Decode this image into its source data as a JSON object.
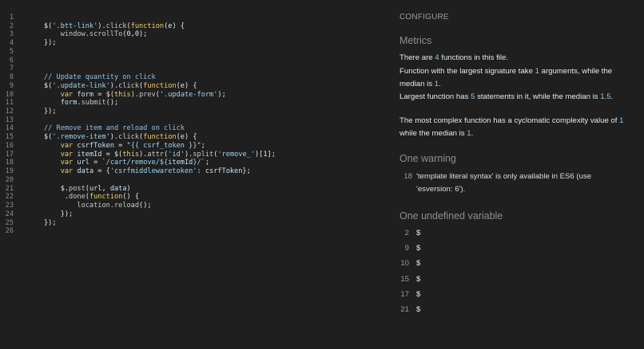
{
  "editor": {
    "lines": [
      {
        "n": "1",
        "code": []
      },
      {
        "n": "2",
        "code": [
          [
            "def",
            "$("
          ],
          [
            "str",
            "'.btt-link'"
          ],
          [
            "def",
            ")."
          ],
          [
            "prop",
            "click"
          ],
          [
            "def",
            "("
          ],
          [
            "kw",
            "function"
          ],
          [
            "def",
            "(e) {"
          ]
        ]
      },
      {
        "n": "3",
        "code": [
          [
            "def",
            "    "
          ],
          [
            "prop",
            "window.scrollTo"
          ],
          [
            "def",
            "(0,0);"
          ]
        ]
      },
      {
        "n": "4",
        "code": [
          [
            "def",
            "});"
          ]
        ]
      },
      {
        "n": "5",
        "code": []
      },
      {
        "n": "6",
        "code": []
      },
      {
        "n": "7",
        "code": []
      },
      {
        "n": "8",
        "code": [
          [
            "com",
            "// Update quantity on click"
          ]
        ]
      },
      {
        "n": "9",
        "code": [
          [
            "def",
            "$("
          ],
          [
            "str",
            "'.update-link'"
          ],
          [
            "def",
            ")."
          ],
          [
            "prop",
            "click"
          ],
          [
            "def",
            "("
          ],
          [
            "kw",
            "function"
          ],
          [
            "def",
            "(e) {"
          ]
        ]
      },
      {
        "n": "10",
        "code": [
          [
            "def",
            "    "
          ],
          [
            "kw",
            "var"
          ],
          [
            "def",
            " "
          ],
          [
            "var",
            "form"
          ],
          [
            "def",
            " = $("
          ],
          [
            "kw",
            "this"
          ],
          [
            "def",
            ")."
          ],
          [
            "prop",
            "prev"
          ],
          [
            "def",
            "("
          ],
          [
            "str",
            "'.update-form'"
          ],
          [
            "def",
            ");"
          ]
        ]
      },
      {
        "n": "11",
        "code": [
          [
            "def",
            "    "
          ],
          [
            "var",
            "form"
          ],
          [
            "def",
            "."
          ],
          [
            "prop",
            "submit"
          ],
          [
            "def",
            "();"
          ]
        ]
      },
      {
        "n": "12",
        "code": [
          [
            "def",
            "});"
          ]
        ]
      },
      {
        "n": "13",
        "code": []
      },
      {
        "n": "14",
        "code": [
          [
            "com",
            "// Remove item and reload on click"
          ]
        ]
      },
      {
        "n": "15",
        "code": [
          [
            "def",
            "$("
          ],
          [
            "str",
            "'.remove-item'"
          ],
          [
            "def",
            ")."
          ],
          [
            "prop",
            "click"
          ],
          [
            "def",
            "("
          ],
          [
            "kw",
            "function"
          ],
          [
            "def",
            "(e) {"
          ]
        ]
      },
      {
        "n": "16",
        "code": [
          [
            "def",
            "    "
          ],
          [
            "kw",
            "var"
          ],
          [
            "def",
            " "
          ],
          [
            "var",
            "csrfToken"
          ],
          [
            "def",
            " = "
          ],
          [
            "str",
            "\"{{ csrf_token }}\""
          ],
          [
            "def",
            ";"
          ]
        ]
      },
      {
        "n": "17",
        "code": [
          [
            "def",
            "    "
          ],
          [
            "kw",
            "var"
          ],
          [
            "def",
            " "
          ],
          [
            "var",
            "itemId"
          ],
          [
            "def",
            " = $("
          ],
          [
            "kw",
            "this"
          ],
          [
            "def",
            ")."
          ],
          [
            "prop",
            "attr"
          ],
          [
            "def",
            "("
          ],
          [
            "str",
            "'id'"
          ],
          [
            "def",
            ")."
          ],
          [
            "prop",
            "split"
          ],
          [
            "def",
            "("
          ],
          [
            "str",
            "'remove_'"
          ],
          [
            "def",
            ")[1];"
          ]
        ]
      },
      {
        "n": "18",
        "code": [
          [
            "def",
            "    "
          ],
          [
            "kw",
            "var"
          ],
          [
            "def",
            " "
          ],
          [
            "var",
            "url"
          ],
          [
            "def",
            " = "
          ],
          [
            "str",
            "`/cart/remove/${"
          ],
          [
            "var",
            "itemId"
          ],
          [
            "str",
            "}/`"
          ],
          [
            "def",
            ";"
          ]
        ]
      },
      {
        "n": "19",
        "code": [
          [
            "def",
            "    "
          ],
          [
            "kw",
            "var"
          ],
          [
            "def",
            " "
          ],
          [
            "var",
            "data"
          ],
          [
            "def",
            " = {"
          ],
          [
            "str",
            "'csrfmiddlewaretoken'"
          ],
          [
            "def",
            ": "
          ],
          [
            "var",
            "csrfToken"
          ],
          [
            "def",
            "};"
          ]
        ]
      },
      {
        "n": "20",
        "code": []
      },
      {
        "n": "21",
        "code": [
          [
            "def",
            "    $."
          ],
          [
            "prop",
            "post"
          ],
          [
            "def",
            "("
          ],
          [
            "var",
            "url"
          ],
          [
            "def",
            ", "
          ],
          [
            "var",
            "data"
          ],
          [
            "def",
            ")"
          ]
        ]
      },
      {
        "n": "22",
        "code": [
          [
            "def",
            "     ."
          ],
          [
            "prop",
            "done"
          ],
          [
            "def",
            "("
          ],
          [
            "kw",
            "function"
          ],
          [
            "def",
            "() {"
          ]
        ]
      },
      {
        "n": "23",
        "code": [
          [
            "def",
            "        "
          ],
          [
            "prop",
            "location.reload"
          ],
          [
            "def",
            "();"
          ]
        ]
      },
      {
        "n": "24",
        "code": [
          [
            "def",
            "    });"
          ]
        ]
      },
      {
        "n": "25",
        "code": [
          [
            "def",
            "});"
          ]
        ]
      },
      {
        "n": "26",
        "code": []
      }
    ]
  },
  "panel": {
    "configure": "CONFIGURE",
    "metrics_title": "Metrics",
    "metrics": {
      "m1_pre": "There are ",
      "m1_num": "4",
      "m1_post": " functions in this file.",
      "m2_pre": "Function with the largest signature take ",
      "m2_num": "1",
      "m2_mid": " arguments, while the median is ",
      "m2_num2": "1",
      "m2_post": ".",
      "m3_pre": "Largest function has ",
      "m3_num": "5",
      "m3_mid": " statements in it, while the median is ",
      "m3_num2": "1.5",
      "m3_post": ".",
      "m4_pre": "The most complex function has a cyclomatic complexity value of ",
      "m4_num": "1",
      "m4_mid": " while the median is ",
      "m4_num2": "1",
      "m4_post": "."
    },
    "warning_title": "One warning",
    "warning": {
      "line": "18",
      "text": "'template literal syntax' is only available in ES6 (use 'esversion: 6')."
    },
    "undefined_title": "One undefined variable",
    "undefined": [
      {
        "line": "2",
        "name": "$"
      },
      {
        "line": "9",
        "name": "$"
      },
      {
        "line": "10",
        "name": "$"
      },
      {
        "line": "15",
        "name": "$"
      },
      {
        "line": "17",
        "name": "$"
      },
      {
        "line": "21",
        "name": "$"
      }
    ],
    "colors": {
      "number": "#8fc6ee",
      "background": "#1f1f1f"
    }
  }
}
